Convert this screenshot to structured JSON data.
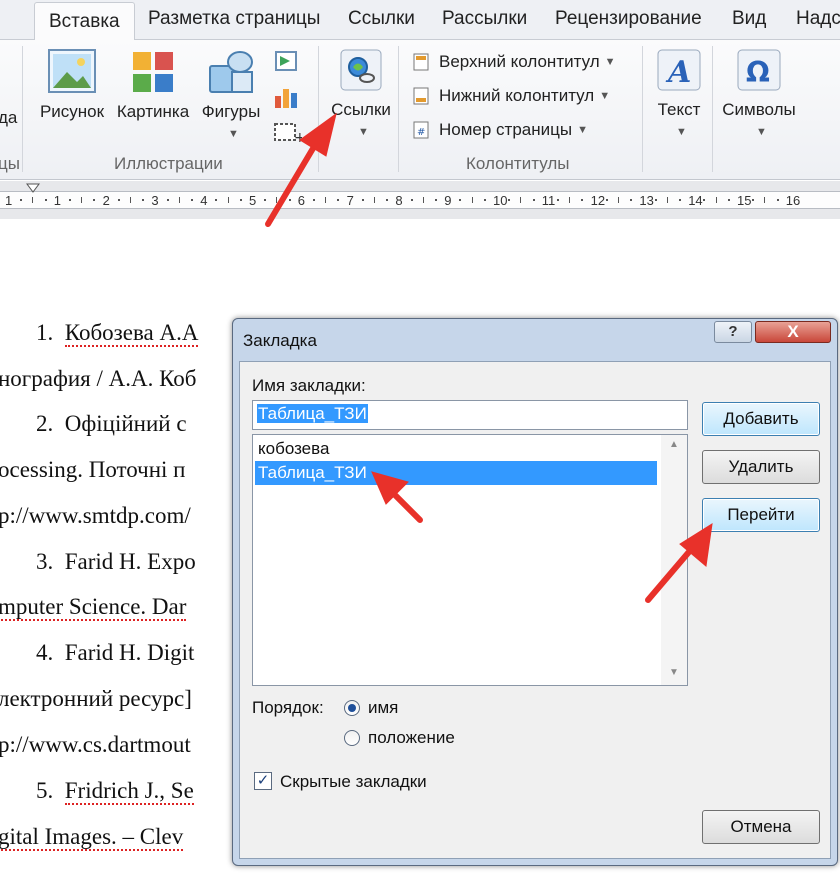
{
  "ribbon": {
    "tabs": [
      {
        "label": "Вставка",
        "active": true
      },
      {
        "label": "Разметка страницы"
      },
      {
        "label": "Ссылки"
      },
      {
        "label": "Рассылки"
      },
      {
        "label": "Рецензирование"
      },
      {
        "label": "Вид"
      },
      {
        "label": "Надст"
      }
    ],
    "left_cut_label": "да",
    "left_cut_group": "цы",
    "illustrations": {
      "picture": "Рисунок",
      "clipart": "Картинка",
      "shapes": "Фигуры",
      "group_label": "Иллюстрации"
    },
    "links": {
      "label": "Ссылки"
    },
    "header_footer": {
      "header": "Верхний колонтитул",
      "footer": "Нижний колонтитул",
      "page_number": "Номер страницы",
      "group_label": "Колонтитулы"
    },
    "text": {
      "label": "Текст"
    },
    "symbols": {
      "label": "Символы"
    }
  },
  "ruler": {
    "labels": [
      "1",
      "1",
      "2",
      "3",
      "4",
      "5",
      "6",
      "7",
      "8",
      "9",
      "10",
      "11",
      "12",
      "13",
      "14",
      "15",
      "16"
    ]
  },
  "document": {
    "lines": [
      {
        "num": "1.",
        "text": "Кобозева А.А"
      },
      {
        "text": "нография / А.А. Коб"
      },
      {
        "num": "2.",
        "text": "Офіційний   с"
      },
      {
        "text": "ocessing.  Поточні  п"
      },
      {
        "text": "p://www.smtdp.com/"
      },
      {
        "num": "3.",
        "text": "Farid H. Expo"
      },
      {
        "text": "mputer Science. Dar"
      },
      {
        "num": "4.",
        "text": "Farid H. Digit"
      },
      {
        "text": "лектронний ресурс]"
      },
      {
        "text": "p://www.cs.dartmout"
      },
      {
        "num": "5.",
        "text": "Fridrich  J.,  Se"
      },
      {
        "text": "gital  Images.  –  Clev"
      }
    ]
  },
  "dialog": {
    "title": "Закладка",
    "help": "?",
    "close": "X",
    "name_label": "Имя закладки:",
    "name_value": "Таблица_ТЗИ",
    "bookmarks": [
      {
        "name": "кобозева",
        "selected": false
      },
      {
        "name": "Таблица_ТЗИ",
        "selected": true
      }
    ],
    "buttons": {
      "add": "Добавить",
      "delete": "Удалить",
      "goto": "Перейти",
      "cancel": "Отмена"
    },
    "sort_label": "Порядок:",
    "sort_options": [
      {
        "label": "имя",
        "checked": true
      },
      {
        "label": "положение",
        "checked": false
      }
    ],
    "hidden_label": "Скрытые закладки",
    "hidden_checked": true
  },
  "colors": {
    "arrow": "#e8312a",
    "selection": "#3399ff"
  }
}
